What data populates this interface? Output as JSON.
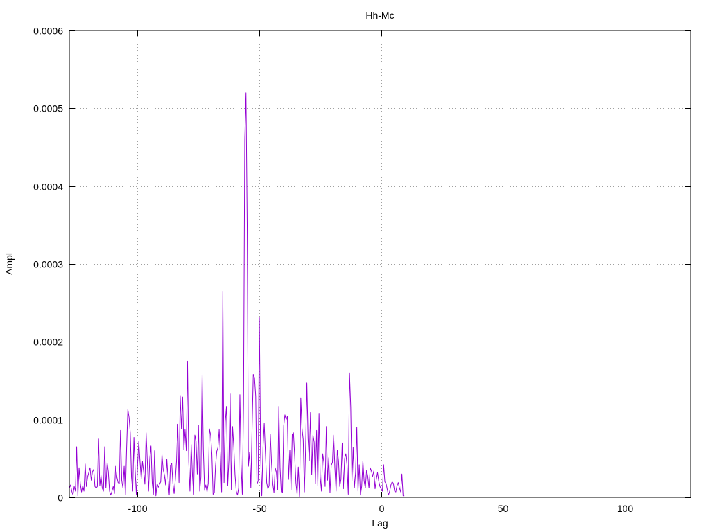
{
  "chart_data": {
    "type": "line",
    "title": "Hh-Mc",
    "xlabel": "Lag",
    "ylabel": "Ampl",
    "xlim": [
      -128,
      127
    ],
    "ylim": [
      0,
      0.0006
    ],
    "x_ticks": [
      -100,
      -50,
      0,
      50,
      100
    ],
    "x_tick_labels": [
      "-100",
      "-50",
      "0",
      "50",
      "100"
    ],
    "y_ticks": [
      0,
      0.0001,
      0.0002,
      0.0003,
      0.0004,
      0.0005,
      0.0006
    ],
    "y_tick_labels": [
      "0",
      "0.0001",
      "0.0002",
      "0.0003",
      "0.0004",
      "0.0005",
      "0.0006"
    ],
    "grid": true,
    "grid_style": "dotted",
    "legend": "none",
    "series_color": "#9400d3",
    "series": [
      {
        "x_start": -128,
        "x_step": 0.5,
        "values": [
          1.2e-05,
          1.6e-05,
          8e-06,
          3e-06,
          1.4e-05,
          8e-06,
          6.5e-05,
          2e-06,
          3.8e-05,
          1.8e-05,
          7e-06,
          1.5e-05,
          8e-06,
          4.3e-05,
          1.4e-05,
          2.6e-05,
          3.2e-05,
          3.8e-05,
          2.2e-05,
          3.3e-05,
          3.6e-05,
          1.4e-05,
          1.2e-05,
          1.4e-05,
          7.5e-05,
          1.5e-05,
          2.8e-05,
          1.2e-05,
          8e-06,
          6.5e-05,
          1.2e-05,
          4.5e-05,
          3.3e-05,
          8e-06,
          3e-06,
          8e-06,
          1.4e-05,
          5e-06,
          4e-05,
          2.6e-05,
          1.9e-05,
          1.8e-05,
          8.6e-05,
          2.2e-05,
          1.2e-05,
          4e-05,
          3e-06,
          6.3e-05,
          0.000113,
          0.000103,
          8.3e-05,
          2.6e-05,
          8e-06,
          7.7e-05,
          3.5e-05,
          3e-06,
          4.3e-05,
          7.2e-05,
          4.6e-05,
          2.4e-05,
          4.6e-05,
          3.3e-05,
          1.7e-05,
          8.3e-05,
          4.6e-05,
          8e-06,
          5e-05,
          6.6e-05,
          1.9e-05,
          4e-06,
          6e-05,
          2e-06,
          1.8e-05,
          1.3e-05,
          1.7e-05,
          2e-05,
          5.5e-05,
          3.6e-05,
          2.9e-05,
          1.6e-05,
          4.9e-05,
          2.4e-05,
          3e-06,
          4.1e-05,
          4.4e-05,
          1.8e-05,
          5e-06,
          2.3e-05,
          4.8e-05,
          9.4e-05,
          1.9e-05,
          0.000131,
          8.8e-05,
          0.000129,
          6.1e-05,
          8.7e-05,
          6e-05,
          0.000175,
          4.6e-05,
          8e-06,
          6.8e-05,
          3e-05,
          4e-06,
          8e-05,
          7.2e-05,
          3e-05,
          9.3e-05,
          8e-06,
          2.6e-05,
          0.000159,
          6.2e-05,
          9e-06,
          1.6e-05,
          7e-06,
          1.8e-05,
          8.8e-05,
          8e-05,
          5.6e-05,
          4e-06,
          6e-06,
          4e-05,
          5.9e-05,
          6.4e-05,
          8.7e-05,
          5.3e-05,
          7e-06,
          0.000265,
          1.9e-05,
          9.7e-05,
          0.000117,
          1.5e-05,
          4.8e-05,
          0.000133,
          1e-05,
          9.1e-05,
          6.5e-05,
          2.9e-05,
          8e-06,
          3e-06,
          1.2e-05,
          0.000132,
          4.2e-05,
          4e-06,
          0.00012,
          0.00046,
          0.00052,
          0.00035,
          4e-05,
          5.8e-05,
          1.2e-05,
          8.7e-05,
          0.000158,
          0.000154,
          0.00013,
          1.7e-05,
          2.1e-05,
          0.000231,
          5.7e-05,
          2e-06,
          6.4e-05,
          9.5e-05,
          5.6e-05,
          1.9e-05,
          1.1e-05,
          1.5e-05,
          8.1e-05,
          4.4e-05,
          1.8e-05,
          6e-06,
          3.8e-05,
          3.2e-05,
          1e-05,
          0.000117,
          3.8e-05,
          7e-06,
          6e-06,
          9.2e-05,
          0.000106,
          0.0001,
          0.000104,
          2.3e-05,
          6.1e-05,
          1e-05,
          8.1e-05,
          8.3e-05,
          5.3e-05,
          1.9e-05,
          4e-06,
          3.9e-05,
          1e-06,
          0.000128,
          8.9e-05,
          7.4e-05,
          7e-06,
          6.6e-05,
          0.000147,
          7.5e-05,
          4.7e-05,
          0.000109,
          2.9e-05,
          8e-05,
          7.1e-05,
          1.8e-05,
          8.6e-05,
          1.5e-05,
          0.000108,
          2.6e-05,
          8e-06,
          5.6e-05,
          4.5e-05,
          1.4e-05,
          9.1e-05,
          2.2e-05,
          5.1e-05,
          6e-06,
          4.1e-05,
          4.5e-05,
          8e-05,
          3.8e-05,
          8e-06,
          6.1e-05,
          4.7e-05,
          1.4e-05,
          2.3e-05,
          7e-05,
          1.1e-05,
          5e-05,
          5.6e-05,
          4.1e-05,
          4e-06,
          0.00016,
          0.000116,
          2.1e-05,
          6.4e-05,
          1.2e-05,
          3.2e-05,
          9e-05,
          8e-06,
          4.2e-05,
          3e-06,
          1.4e-05,
          4.7e-05,
          2.1e-05,
          1.2e-05,
          3.5e-05,
          2.7e-05,
          1.2e-05,
          3.8e-05,
          3.4e-05,
          2.7e-05,
          3.4e-05,
          1.1e-05,
          2.3e-05,
          3.2e-05,
          2.1e-05,
          1.4e-05,
          1.1e-05,
          8e-06,
          4.2e-05,
          2e-05,
          1.8e-05,
          1e-05,
          3e-06,
          8e-06,
          1.6e-05,
          2e-05,
          1.8e-05,
          8e-06,
          7e-06,
          1.5e-05,
          1.9e-05,
          1.2e-05,
          7e-06,
          3e-05,
          2e-06,
          2e-06
        ]
      }
    ]
  }
}
